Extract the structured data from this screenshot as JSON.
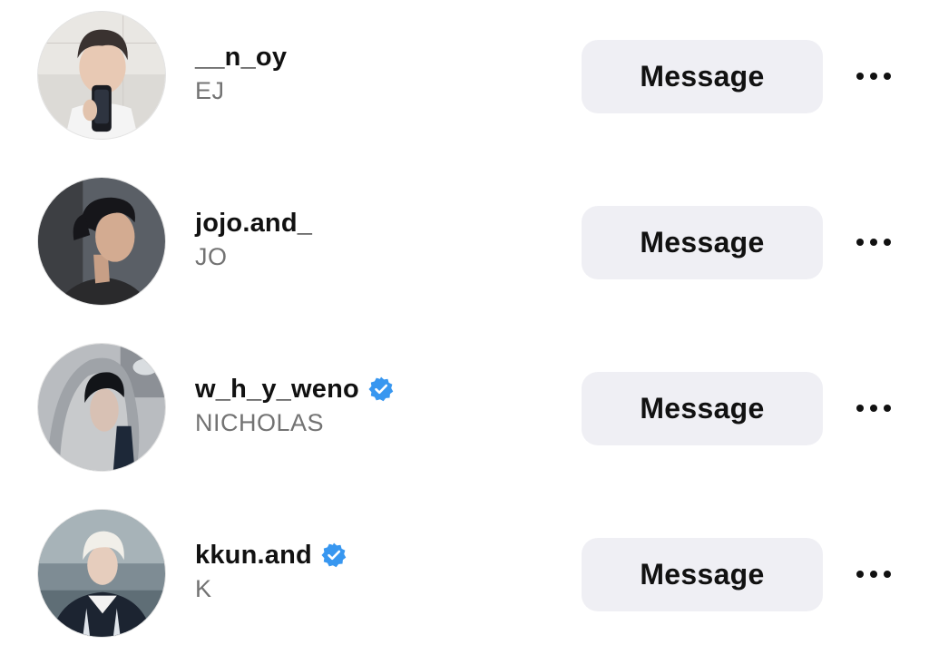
{
  "users": [
    {
      "username": "__n_oy",
      "full_name": "EJ",
      "verified": false,
      "action_label": "Message"
    },
    {
      "username": "jojo.and_",
      "full_name": "JO",
      "verified": false,
      "action_label": "Message"
    },
    {
      "username": "w_h_y_weno",
      "full_name": "NICHOLAS",
      "verified": true,
      "action_label": "Message"
    },
    {
      "username": "kkun.and",
      "full_name": "K",
      "verified": true,
      "action_label": "Message"
    }
  ],
  "colors": {
    "button_bg": "#efeff4",
    "username_text": "#111111",
    "fullname_text": "#737373",
    "verified_badge": "#3897f0"
  },
  "icons": {
    "more": "more-horizontal-icon",
    "verified": "verified-badge-icon"
  }
}
